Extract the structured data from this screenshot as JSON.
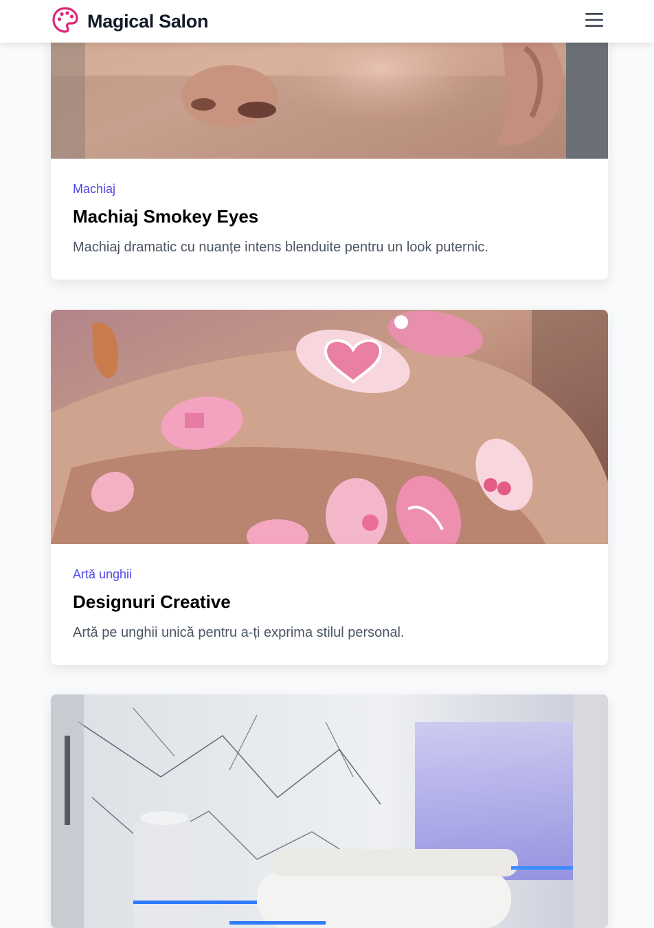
{
  "header": {
    "brand": "Magical Salon",
    "logo_icon": "palette-icon",
    "menu_icon": "hamburger-menu-icon",
    "accent": "#db2777"
  },
  "cards": [
    {
      "category": "Machiaj",
      "title": "Machiaj Smokey Eyes",
      "description": "Machiaj dramatic cu nuanțe intens blenduite pentru un look puternic."
    },
    {
      "category": "Artă unghii",
      "title": "Designuri Creative",
      "description": "Artă pe unghii unică pentru a-ți exprima stilul personal."
    },
    {
      "category": "",
      "title": "",
      "description": ""
    }
  ],
  "colors": {
    "category": "#4f46e5",
    "title": "#000000",
    "description": "#4b5563"
  }
}
